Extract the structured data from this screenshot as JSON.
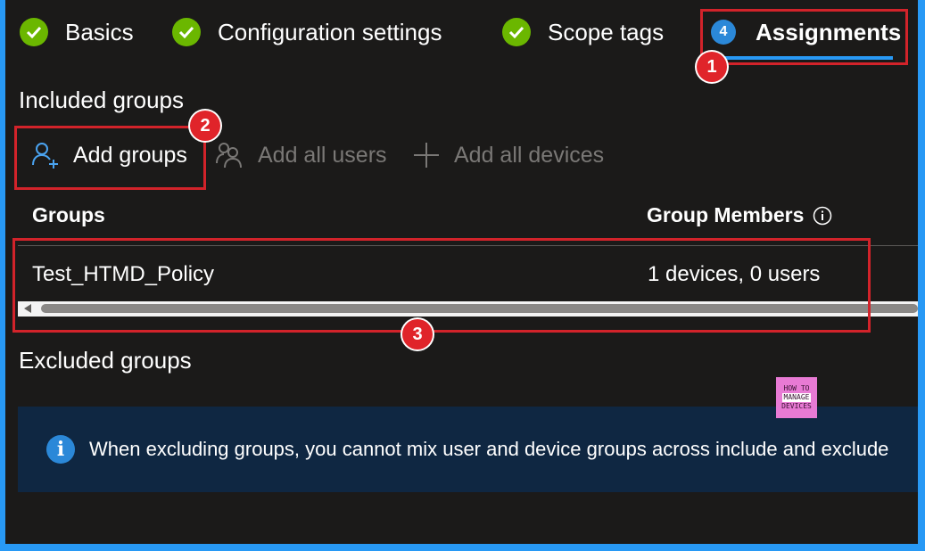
{
  "tabs": [
    {
      "label": "Basics",
      "state": "complete"
    },
    {
      "label": "Configuration settings",
      "state": "complete"
    },
    {
      "label": "Scope tags",
      "state": "complete"
    },
    {
      "label": "Assignments",
      "state": "active",
      "step": "4"
    }
  ],
  "annotations": {
    "badge1": "1",
    "badge2": "2",
    "badge3": "3"
  },
  "included": {
    "title": "Included groups",
    "toolbar": {
      "add_groups": "Add groups",
      "add_all_users": "Add all users",
      "add_all_devices": "Add all devices"
    },
    "table": {
      "columns": [
        "Groups",
        "Group Members"
      ],
      "rows": [
        {
          "group": "Test_HTMD_Policy",
          "members": "1 devices, 0 users"
        }
      ]
    }
  },
  "excluded": {
    "title": "Excluded groups",
    "info_text": "When excluding groups, you cannot mix user and device groups across include and exclude"
  },
  "logo": {
    "line1": "HOW TO",
    "line2": "MANAGE",
    "line3": "DEVICES"
  },
  "colors": {
    "accent": "#2899f5",
    "success": "#6bb700",
    "annotation_red": "#d2232a",
    "background": "#1b1a19",
    "info_banner": "#0f2742"
  }
}
